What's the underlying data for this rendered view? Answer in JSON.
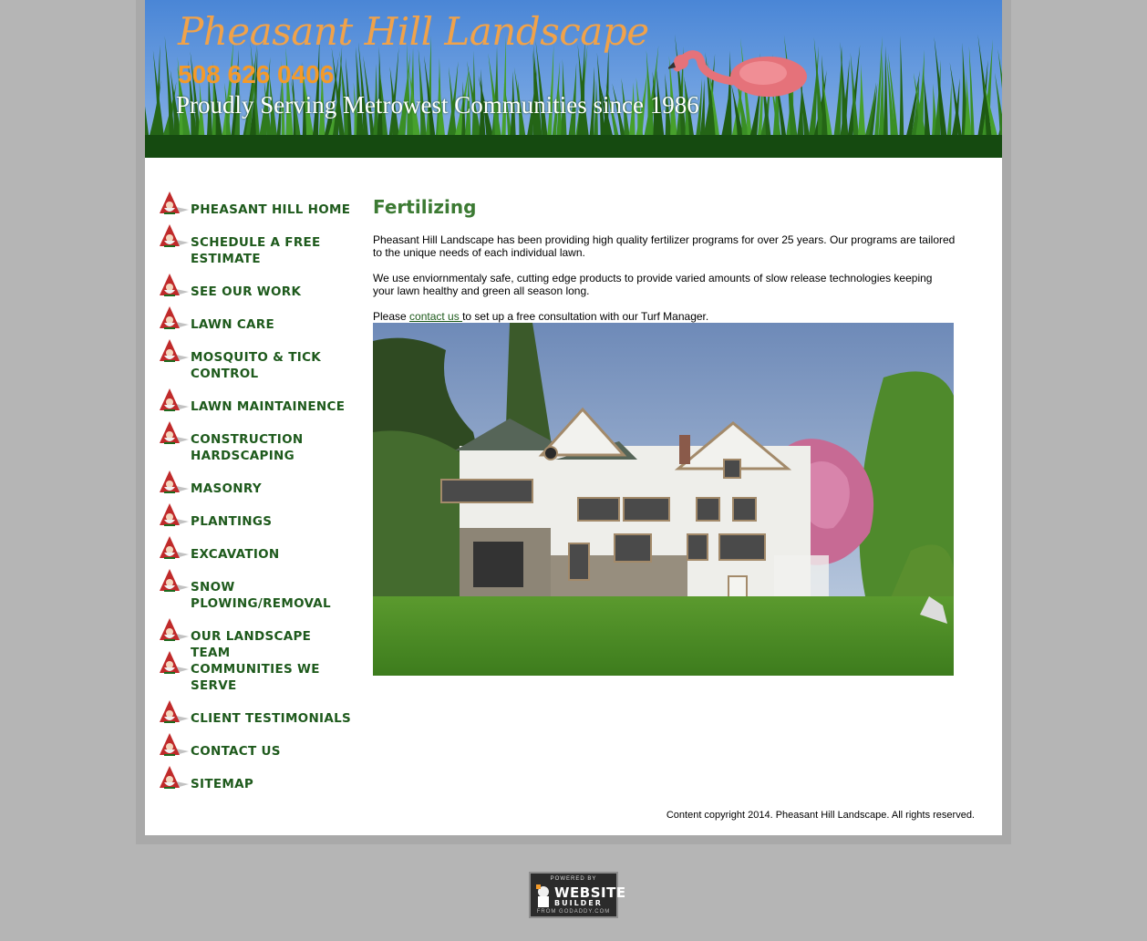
{
  "header": {
    "title": "Pheasant Hill Landscape",
    "phone": "508 626 0406",
    "tagline": "Proudly Serving Metrowest Communities since 1986"
  },
  "nav": {
    "icon": "gnome-icon",
    "items": [
      {
        "label": "PHEASANT HILL HOME"
      },
      {
        "label": "SCHEDULE A FREE ESTIMATE"
      },
      {
        "label": "SEE OUR WORK"
      },
      {
        "label": "LAWN CARE"
      },
      {
        "label": "MOSQUITO & TICK CONTROL"
      },
      {
        "label": "LAWN MAINTAINENCE"
      },
      {
        "label": "CONSTRUCTION HARDSCAPING"
      },
      {
        "label": "MASONRY"
      },
      {
        "label": "PLANTINGS"
      },
      {
        "label": "EXCAVATION"
      },
      {
        "label": "SNOW PLOWING/REMOVAL"
      },
      {
        "label": "OUR LANDSCAPE TEAM"
      },
      {
        "label": "COMMUNITIES WE SERVE"
      },
      {
        "label": "CLIENT TESTIMONIALS"
      },
      {
        "label": "CONTACT US"
      },
      {
        "label": "SITEMAP"
      }
    ]
  },
  "main": {
    "heading": "Fertilizing",
    "para1": "Pheasant Hill Landscape has been providing high quality  fertilizer programs for over 25 years. Our programs are tailored to the unique needs of each individual lawn.",
    "para2": "We use enviornmentaly safe, cutting edge products to provide varied amounts of slow release technologies keeping your lawn healthy and green all season long.",
    "para3_before": "Please ",
    "para3_link": "contact us ",
    "para3_after": "to set up a free consultation with our Turf Manager."
  },
  "footer": {
    "copyright": "Content copyright 2014. Pheasant Hill Landscape. All rights reserved."
  },
  "badge": {
    "line1": "POWERED BY",
    "line2": "WEBSITE",
    "line3": "BUILDER",
    "line4": "FROM GODADDY.COM"
  },
  "colors": {
    "page_bg": "#b5b5b5",
    "nav_text": "#1e5a1c",
    "heading": "#3c7a33",
    "phone": "#f39a2a",
    "title": "#f0a24a",
    "grass_dark": "#154a10"
  }
}
